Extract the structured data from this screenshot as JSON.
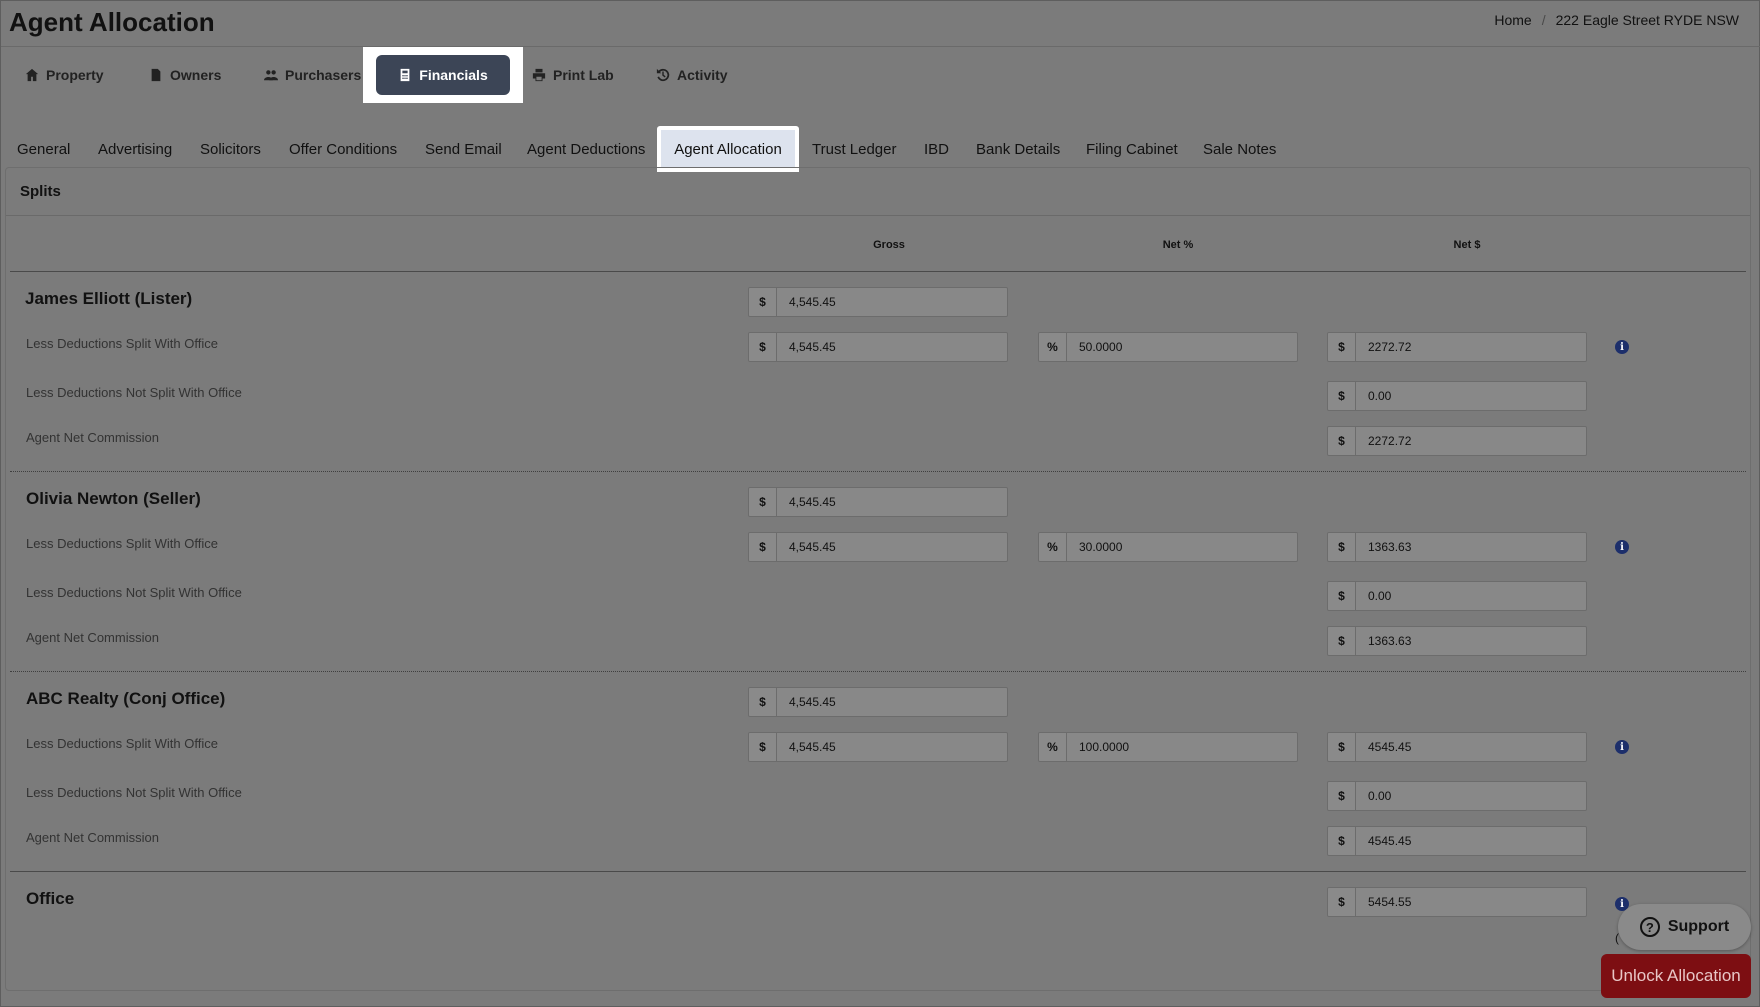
{
  "header": {
    "title": "Agent Allocation",
    "breadcrumb": [
      "Home",
      "/",
      "222 Eagle Street RYDE NSW"
    ]
  },
  "main_nav": [
    {
      "label": "Property",
      "icon": "home-icon"
    },
    {
      "label": "Owners",
      "icon": "document-icon"
    },
    {
      "label": "Purchasers",
      "icon": "users-icon"
    },
    {
      "label": "Financials",
      "icon": "calculator-icon",
      "active": true
    },
    {
      "label": "Print Lab",
      "icon": "printer-icon"
    },
    {
      "label": "Activity",
      "icon": "history-icon"
    }
  ],
  "sub_tabs": [
    {
      "label": "General"
    },
    {
      "label": "Advertising"
    },
    {
      "label": "Solicitors"
    },
    {
      "label": "Offer Conditions"
    },
    {
      "label": "Send Email"
    },
    {
      "label": "Agent Deductions"
    },
    {
      "label": "Agent Allocation",
      "active": true
    },
    {
      "label": "Trust Ledger"
    },
    {
      "label": "IBD"
    },
    {
      "label": "Bank Details"
    },
    {
      "label": "Filing Cabinet"
    },
    {
      "label": "Sale Notes"
    }
  ],
  "panel": {
    "title": "Splits",
    "columns": {
      "gross": "Gross",
      "net_pct": "Net %",
      "net_amt": "Net $"
    },
    "row_labels": {
      "split": "Less Deductions Split With Office",
      "not_split": "Less Deductions Not Split With Office",
      "net": "Agent Net Commission"
    },
    "agents": [
      {
        "name": "James Elliott (Lister)",
        "gross": "4,545.45",
        "split_gross": "4,545.45",
        "split_pct": "50.0000",
        "split_net": "2272.72",
        "not_split": "0.00",
        "net_commission": "2272.72"
      },
      {
        "name": "Olivia Newton (Seller)",
        "gross": "4,545.45",
        "split_gross": "4,545.45",
        "split_pct": "30.0000",
        "split_net": "1363.63",
        "not_split": "0.00",
        "net_commission": "1363.63"
      },
      {
        "name": "ABC Realty (Conj Office)",
        "gross": "4,545.45",
        "split_gross": "4,545.45",
        "split_pct": "100.0000",
        "split_net": "4545.45",
        "not_split": "0.00",
        "net_commission": "4545.45"
      }
    ],
    "office": {
      "name": "Office",
      "net": "5454.55"
    },
    "prefix_dollar": "$",
    "prefix_pct": "%"
  },
  "support_label": "Support",
  "unlock_label": "Unlock Allocation",
  "stray_text": "("
}
